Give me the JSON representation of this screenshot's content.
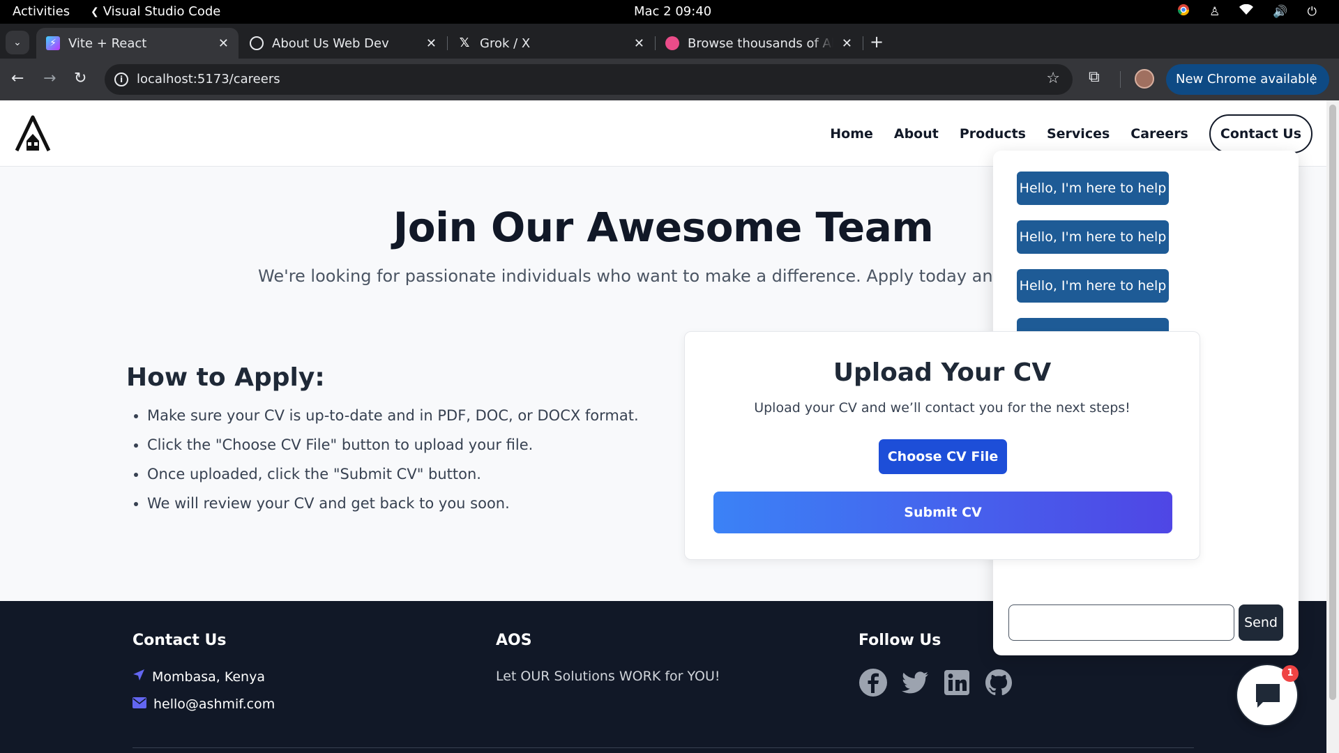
{
  "os": {
    "activities": "Activities",
    "app_name": "Visual Studio Code",
    "clock": "Mac 2  09:40"
  },
  "browser": {
    "tabs": [
      {
        "title": "Vite + React",
        "icon": "vite-icon",
        "active": true
      },
      {
        "title": "About Us Web Dev",
        "icon": "globe-icon",
        "active": false
      },
      {
        "title": "Grok / X",
        "icon": "x-icon",
        "active": false
      },
      {
        "title": "Browse thousands of Ab",
        "icon": "dribbble-icon",
        "active": false
      }
    ],
    "url": "localhost:5173/careers",
    "update_label": "New Chrome available"
  },
  "site": {
    "nav": [
      "Home",
      "About",
      "Products",
      "Services",
      "Careers"
    ],
    "contact_button": "Contact Us"
  },
  "hero": {
    "title": "Join Our Awesome Team",
    "subtitle": "We're looking for passionate individuals who want to make a difference. Apply today and help"
  },
  "how_to_apply": {
    "title": "How to Apply:",
    "steps": [
      "Make sure your CV is up-to-date and in PDF, DOC, or DOCX format.",
      "Click the \"Choose CV File\" button to upload your file.",
      "Once uploaded, click the \"Submit CV\" button.",
      "We will review your CV and get back to you soon."
    ]
  },
  "upload": {
    "title": "Upload Your CV",
    "description": "Upload your CV and we’ll contact you for the next steps!",
    "choose_label": "Choose CV File",
    "submit_label": "Submit CV"
  },
  "chat": {
    "messages": [
      "Hello, I'm here to help",
      "Hello, I'm here to help",
      "Hello, I'm here to help",
      ""
    ],
    "input_value": "",
    "send_label": "Send",
    "badge_count": "1"
  },
  "footer": {
    "contact_title": "Contact Us",
    "location": "Mombasa, Kenya",
    "email": "hello@ashmif.com",
    "brand_title": "AOS",
    "slogan": "Let OUR Solutions WORK for YOU!",
    "follow_title": "Follow Us",
    "social": [
      "facebook-icon",
      "twitter-icon",
      "linkedin-icon",
      "github-icon"
    ]
  },
  "colors": {
    "primary_blue": "#1d4ed8",
    "gradient_start": "#3b82f6",
    "gradient_end": "#4f46e5",
    "chat_bubble": "#1e5b96",
    "footer_bg": "#111827",
    "accent_purple": "#6366f1"
  }
}
